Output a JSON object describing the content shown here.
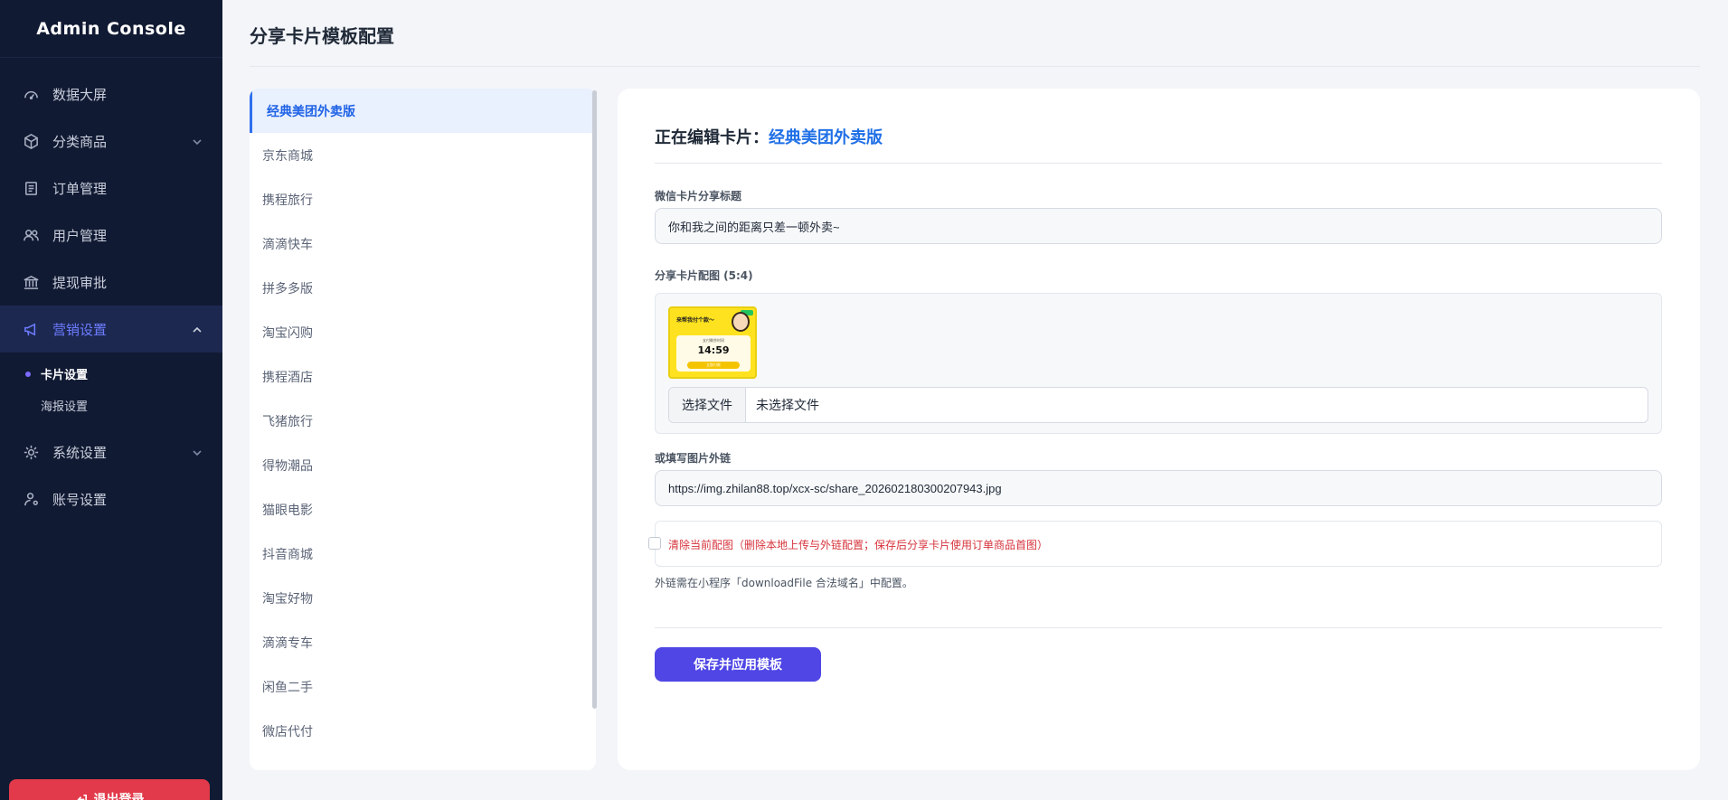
{
  "app": {
    "title": "Admin Console"
  },
  "sidebar": {
    "items": [
      {
        "label": "数据大屏",
        "icon": "dashboard-icon"
      },
      {
        "label": "分类商品",
        "icon": "box-icon"
      },
      {
        "label": "订单管理",
        "icon": "receipt-icon"
      },
      {
        "label": "用户管理",
        "icon": "users-icon"
      },
      {
        "label": "提现审批",
        "icon": "bank-icon"
      },
      {
        "label": "营销设置",
        "icon": "megaphone-icon"
      },
      {
        "label": "系统设置",
        "icon": "gear-icon"
      },
      {
        "label": "账号设置",
        "icon": "user-gear-icon"
      }
    ],
    "submenu": [
      {
        "label": "卡片设置"
      },
      {
        "label": "海报设置"
      }
    ],
    "logout_label": "退出登录"
  },
  "page": {
    "title": "分享卡片模板配置"
  },
  "templates": [
    "经典美团外卖版",
    "京东商城",
    "携程旅行",
    "滴滴快车",
    "拼多多版",
    "淘宝闪购",
    "携程酒店",
    "飞猪旅行",
    "得物潮品",
    "猫眼电影",
    "抖音商城",
    "淘宝好物",
    "滴滴专车",
    "闲鱼二手",
    "微店代付"
  ],
  "editor": {
    "heading_prefix": "正在编辑卡片：",
    "heading_name": "经典美团外卖版",
    "title_label": "微信卡片分享标题",
    "title_value": "你和我之间的距离只差一顿外卖~",
    "image_label": "分享卡片配图 (5:4)",
    "thumbnail": {
      "heading": "来帮我付个款～",
      "caption": "支付剩余时间",
      "time": "14:59",
      "button": "立即付款"
    },
    "file_button": "选择文件",
    "file_status": "未选择文件",
    "url_label": "或填写图片外链",
    "url_value": "https://img.zhilan88.top/xcx-sc/share_202602180300207943.jpg",
    "clear_label": "清除当前配图（删除本地上传与外链配置；保存后分享卡片使用订单商品首图）",
    "hint": "外链需在小程序「downloadFile 合法域名」中配置。",
    "save_label": "保存并应用模板"
  },
  "colors": {
    "sidebar_bg": "#111a33",
    "accent": "#4f46e5",
    "link": "#1f6fe6",
    "danger": "#e23a4a"
  }
}
